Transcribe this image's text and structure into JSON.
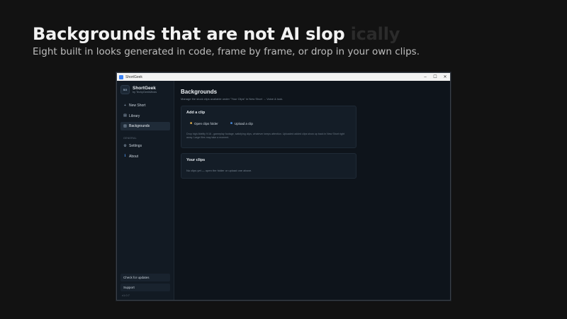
{
  "hero": {
    "title": "Backgrounds that are not AI slop",
    "title_ghost": "ically",
    "subtitle": "Eight built in looks generated in code, frame by frame, or drop in your own clips."
  },
  "window": {
    "title": "ShortGeek",
    "controls": [
      "–",
      "☐",
      "✕"
    ]
  },
  "sidebar": {
    "brand_initials": "SG",
    "brand_name": "ShortGeek",
    "brand_by": "by TechyGeekMinds",
    "items": [
      {
        "label": "New Short",
        "icon": "plus-icon"
      },
      {
        "label": "Library",
        "icon": "library-icon"
      },
      {
        "label": "Backgrounds",
        "icon": "backgrounds-icon",
        "active": true
      }
    ],
    "section_label": "GENERAL",
    "general_items": [
      {
        "label": "Settings",
        "icon": "gear-icon"
      },
      {
        "label": "About",
        "icon": "info-icon"
      }
    ],
    "check_updates": "Check for updates",
    "support": "Support",
    "version": "v1.0.7"
  },
  "main": {
    "title": "Backgrounds",
    "subtitle": "Manage the stock clips available under \"Your Clips\" in New Short → Voice & look.",
    "add_card": {
      "title": "Add a clip",
      "open_folder": "Open clips folder",
      "upload": "Upload a clip",
      "description": "Drop high-fidelity 9:16 - gameplay footage, satisfying clips, whatever keeps attention. Uploaded added clips show up back in New Short right away. Large files may take a moment."
    },
    "clips_card": {
      "title": "Your clips",
      "empty": "No clips yet — open the folder or upload one above."
    }
  },
  "colors": {
    "background": "#121212",
    "window_bg": "#0e141b",
    "sidebar_bg": "#121a23",
    "card_bg": "#141d27",
    "accent": "#3b82f6"
  }
}
